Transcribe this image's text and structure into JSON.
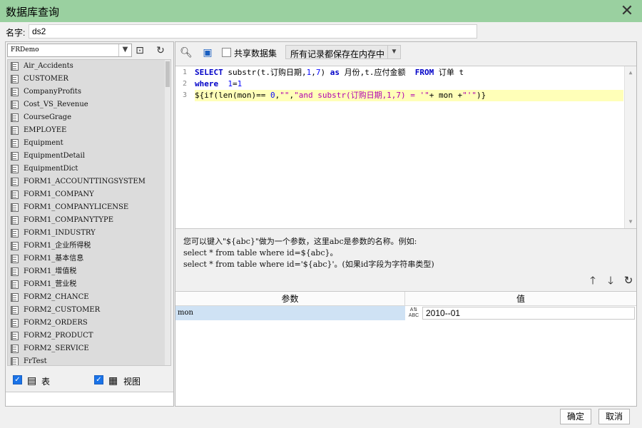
{
  "window": {
    "title": "数据库查询",
    "close_glyph": "✕"
  },
  "name_field": {
    "label": "名字:",
    "value": "ds2"
  },
  "left_panel": {
    "connection": "FRDemo",
    "tables": [
      "Air_Accidents",
      "CUSTOMER",
      "CompanyProfits",
      "Cost_VS_Revenue",
      "CourseGrage",
      "EMPLOYEE",
      "Equipment",
      "EquipmentDetail",
      "EquipmentDict",
      "FORM1_ACCOUNTTINGSYSTEM",
      "FORM1_COMPANY",
      "FORM1_COMPANYLICENSE",
      "FORM1_COMPANYTYPE",
      "FORM1_INDUSTRY",
      "FORM1_企业所得税",
      "FORM1_基本信息",
      "FORM1_增值税",
      "FORM1_营业税",
      "FORM2_CHANCE",
      "FORM2_CUSTOMER",
      "FORM2_ORDERS",
      "FORM2_PRODUCT",
      "FORM2_SERVICE",
      "FrTest"
    ],
    "show_tables_label": "表",
    "show_views_label": "视图"
  },
  "right_panel": {
    "share_dataset_label": "共享数据集",
    "storage_mode": "所有记录都保存在内存中",
    "sql_line_numbers": [
      "1",
      "2",
      "3"
    ],
    "hint_lines": [
      "您可以键入\"${abc}\"做为一个参数，这里abc是参数的名称。例如:",
      "select * from table where id=${abc}。",
      "select * from table where id='${abc}'。(如果id字段为字符串类型)"
    ],
    "params": {
      "col_name": "参数",
      "col_value": "值",
      "rows": [
        {
          "name": "mon",
          "type_icon": "ABC",
          "value": "2010--01"
        }
      ]
    }
  },
  "footer": {
    "ok_label": "确定",
    "cancel_label": "取消"
  },
  "colors": {
    "titlebar": "#9ad0a0",
    "highlight_line": "#ffffb8",
    "selected_row": "#cfe2f4",
    "checkbox": "#1a73e8"
  }
}
